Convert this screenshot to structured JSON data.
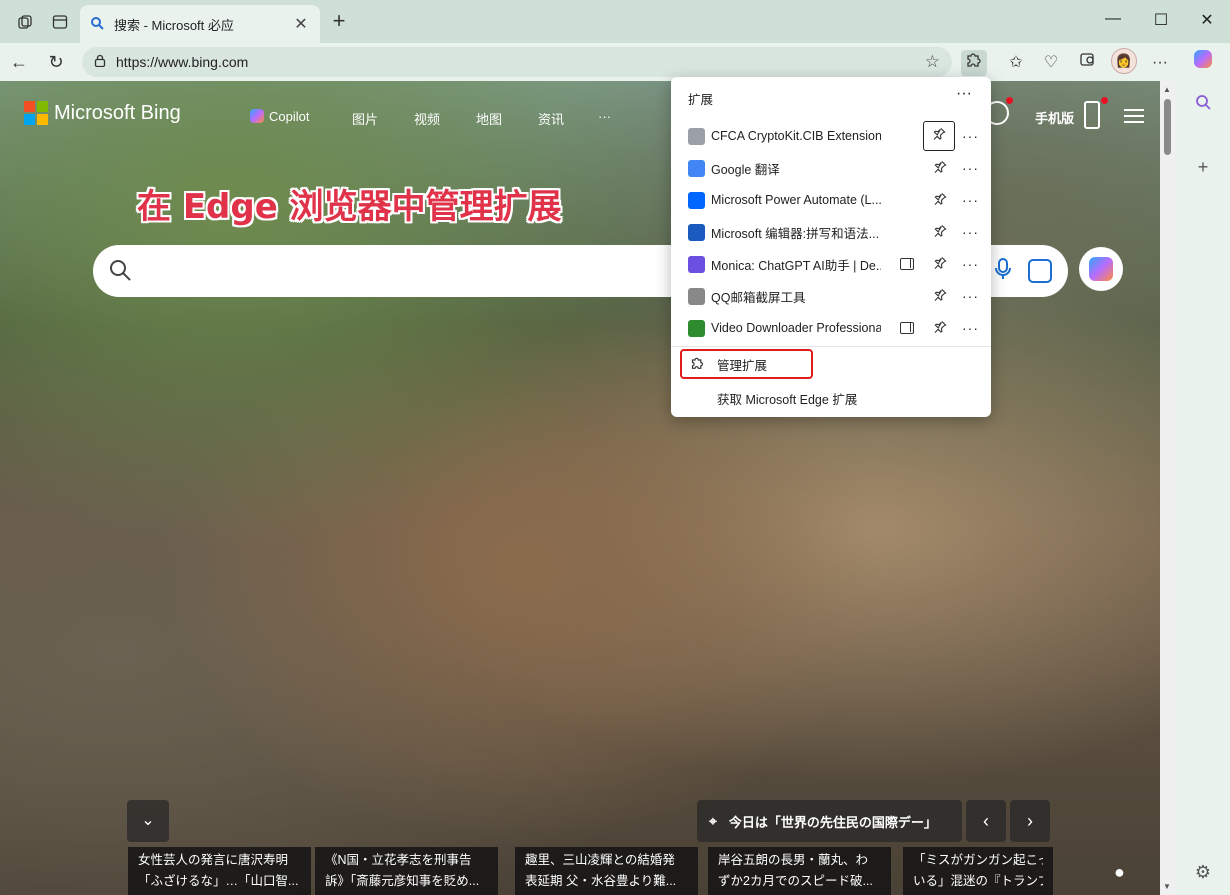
{
  "browser": {
    "tab_title": "搜索 - Microsoft 必应",
    "url": "https://www.bing.com",
    "new_tab": "+",
    "tab_close": "✕",
    "minimize": "—",
    "maximize": "☐",
    "close": "✕"
  },
  "bing": {
    "logo": "Microsoft Bing",
    "nav": [
      "Copilot",
      "图片",
      "视频",
      "地图",
      "资讯",
      "···"
    ],
    "mobile_label": "手机版",
    "headline": "在 Edge 浏览器中管理扩展"
  },
  "extensions_popup": {
    "title": "扩展",
    "more": "···",
    "items": [
      {
        "name": "CFCA CryptoKit.CIB Extension",
        "icon_color": "#9aa0a6",
        "side_panel": false,
        "pin_focused": true
      },
      {
        "name": "Google 翻译",
        "icon_color": "#4285f4",
        "side_panel": false,
        "pin_focused": false
      },
      {
        "name": "Microsoft Power Automate (L...",
        "icon_color": "#0066ff",
        "side_panel": false,
        "pin_focused": false
      },
      {
        "name": "Microsoft 编辑器:拼写和语法...",
        "icon_color": "#185abd",
        "side_panel": false,
        "pin_focused": false
      },
      {
        "name": "Monica: ChatGPT AI助手 | De...",
        "icon_color": "#6b4fe0",
        "side_panel": true,
        "pin_focused": false
      },
      {
        "name": "QQ邮箱截屏工具",
        "icon_color": "#888888",
        "side_panel": false,
        "pin_focused": false
      },
      {
        "name": "Video Downloader Professional",
        "icon_color": "#2e8b2e",
        "side_panel": true,
        "pin_focused": false
      }
    ],
    "manage": "管理扩展",
    "get_more": "获取 Microsoft Edge 扩展"
  },
  "bottom": {
    "day_label": "今日は「世界の先住民の国際デー」",
    "news": [
      [
        "女性芸人の発言に唐沢寿明",
        "「ふざけるな」…「山口智..."
      ],
      [
        "《N国・立花孝志を刑事告",
        "訴》「斎藤元彦知事を貶め..."
      ],
      [
        "趣里、三山凌輝との結婚発",
        "表延期 父・水谷豊より難..."
      ],
      [
        "岸谷五朗の長男・蘭丸、わ",
        "ずか2カ月でのスピード破..."
      ],
      [
        "「ミスがガンガン起こっ",
        "いる」混迷の『トランプ"
      ]
    ]
  },
  "icons": {
    "pin": "📌",
    "search": "search-icon",
    "extensions": "puzzle-icon"
  }
}
